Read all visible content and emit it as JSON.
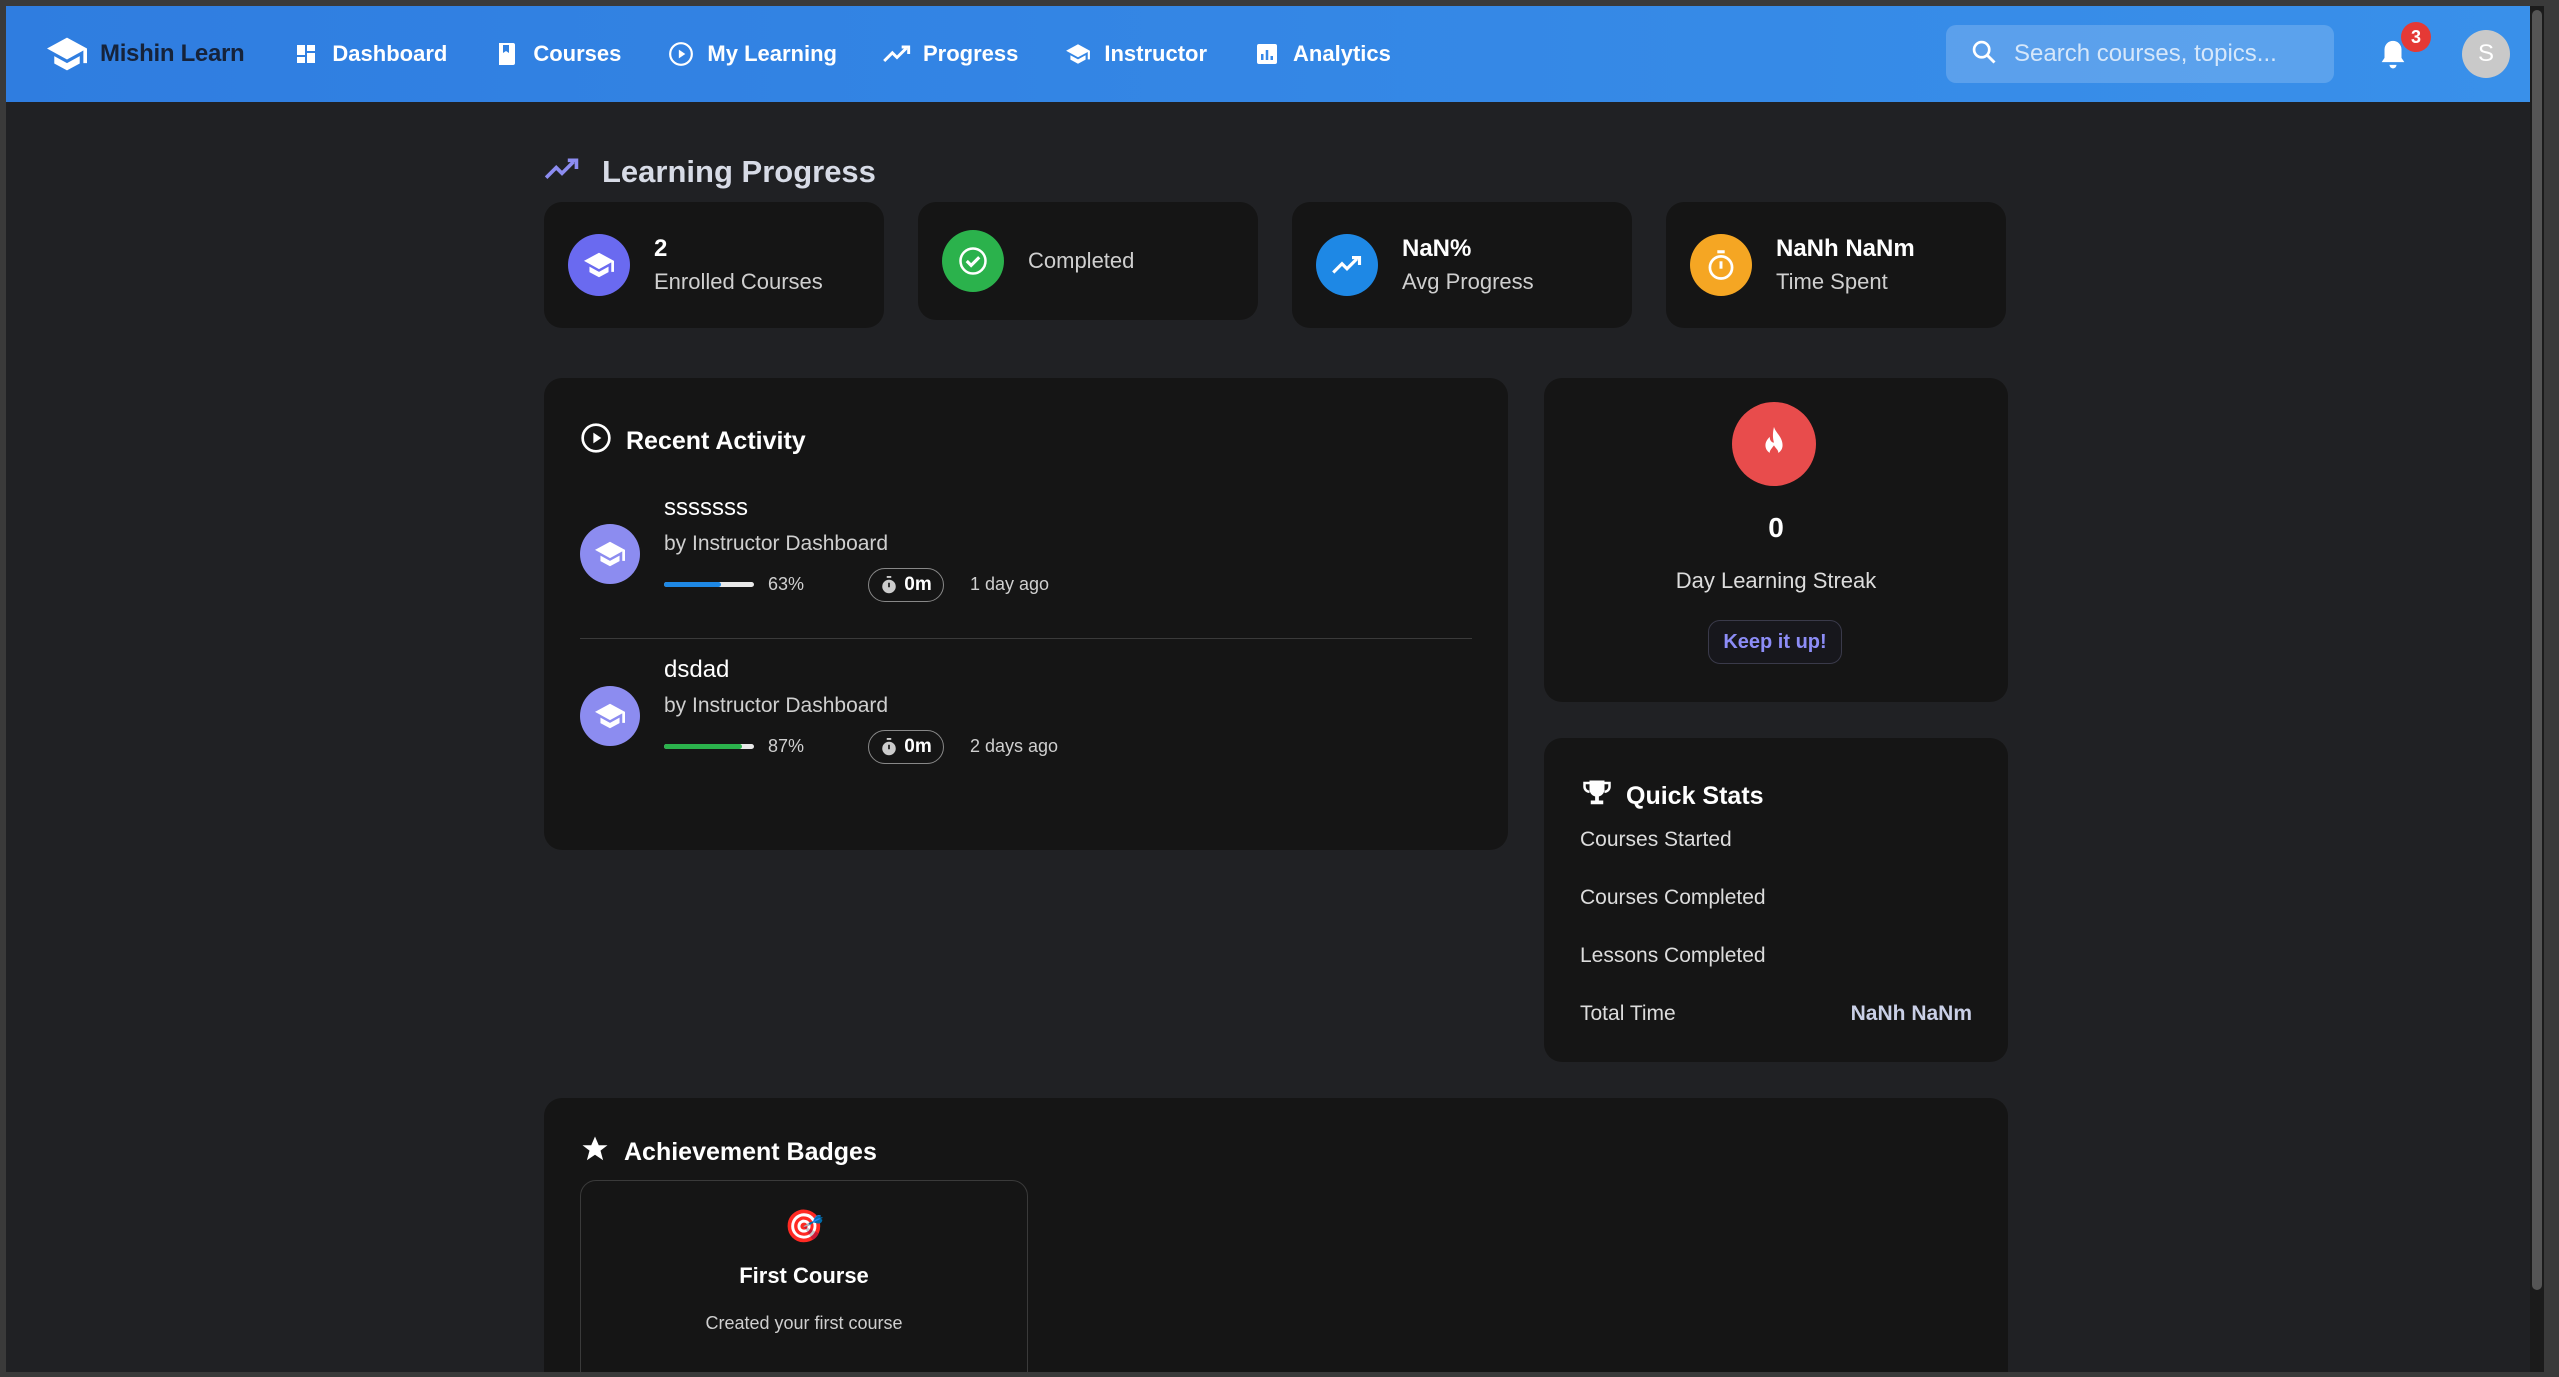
{
  "brand": {
    "name": "Mishin Learn"
  },
  "nav": {
    "items": [
      {
        "label": "Dashboard",
        "icon": "dashboard-icon"
      },
      {
        "label": "Courses",
        "icon": "book-icon"
      },
      {
        "label": "My Learning",
        "icon": "play-circle-icon"
      },
      {
        "label": "Progress",
        "icon": "trending-up-icon"
      },
      {
        "label": "Instructor",
        "icon": "school-icon"
      },
      {
        "label": "Analytics",
        "icon": "analytics-icon"
      }
    ],
    "search_placeholder": "Search courses, topics...",
    "notification_count": "3",
    "avatar_initial": "S"
  },
  "page": {
    "title": "Learning Progress"
  },
  "stats": [
    {
      "value": "2",
      "label": "Enrolled Courses",
      "color": "#6a6af0",
      "icon": "school-icon"
    },
    {
      "value": "",
      "label": "Completed",
      "color": "#2bb24c",
      "icon": "check-circle-icon"
    },
    {
      "value": "NaN%",
      "label": "Avg Progress",
      "color": "#1e88e5",
      "icon": "trending-up-icon"
    },
    {
      "value": "NaNh NaNm",
      "label": "Time Spent",
      "color": "#f5a623",
      "icon": "timer-icon"
    }
  ],
  "recent_activity": {
    "title": "Recent Activity",
    "items": [
      {
        "title": "sssssss",
        "subtitle": "by Instructor Dashboard",
        "progress": 63,
        "progress_label": "63%",
        "progress_color": "#1e88e5",
        "time": "0m",
        "ago": "1 day ago"
      },
      {
        "title": "dsdad",
        "subtitle": "by Instructor Dashboard",
        "progress": 87,
        "progress_label": "87%",
        "progress_color": "#2bb24c",
        "time": "0m",
        "ago": "2 days ago"
      }
    ]
  },
  "streak": {
    "value": "0",
    "label": "Day Learning Streak",
    "button": "Keep it up!"
  },
  "quick_stats": {
    "title": "Quick Stats",
    "rows": [
      {
        "label": "Courses Started",
        "value": ""
      },
      {
        "label": "Courses Completed",
        "value": ""
      },
      {
        "label": "Lessons Completed",
        "value": ""
      },
      {
        "label": "Total Time",
        "value": "NaNh NaNm"
      }
    ]
  },
  "achievements": {
    "title": "Achievement Badges",
    "badges": [
      {
        "emoji": "🎯",
        "title": "First Course",
        "description": "Created your first course"
      }
    ]
  }
}
